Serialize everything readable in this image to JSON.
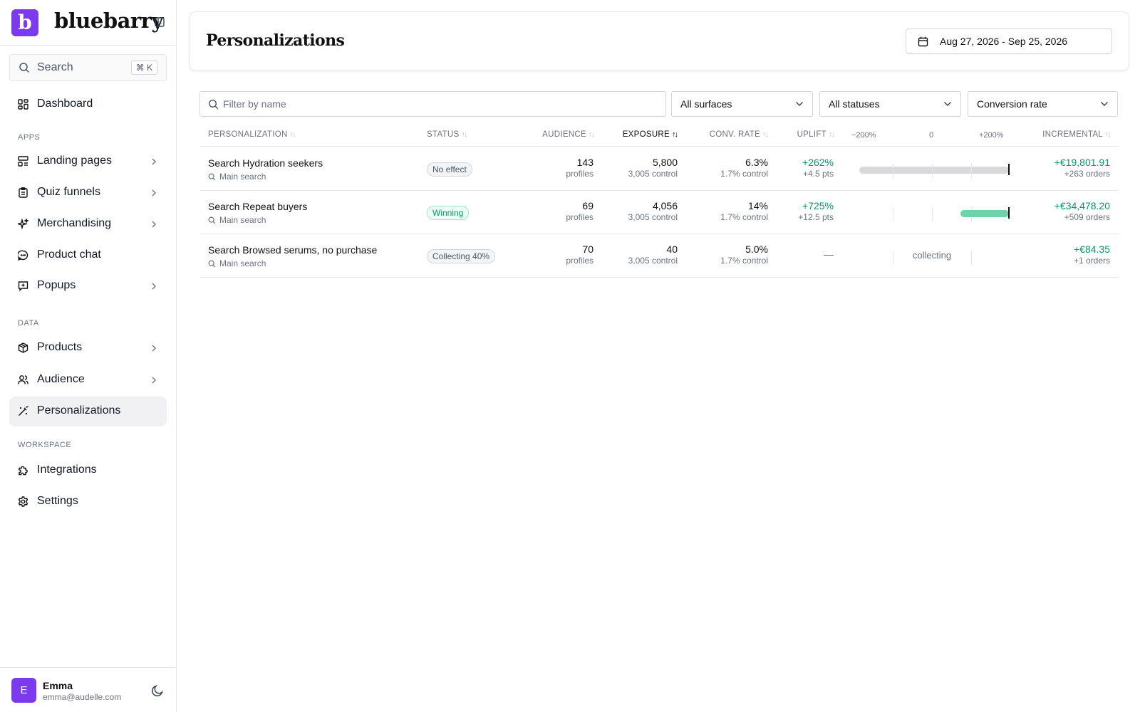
{
  "app": {
    "brand": "bluebarry",
    "logo_letter": "b",
    "accent": "#7c3aed"
  },
  "search": {
    "label": "Search",
    "shortcut": "⌘ K"
  },
  "sidebar": {
    "dashboard": "Dashboard",
    "sections": {
      "apps": "APPS",
      "data": "DATA",
      "workspace": "WORKSPACE"
    },
    "items": {
      "landing": "Landing pages",
      "quiz": "Quiz funnels",
      "merch": "Merchandising",
      "chat": "Product chat",
      "popups": "Popups",
      "products": "Products",
      "audience": "Audience",
      "personalizations": "Personalizations",
      "integrations": "Integrations",
      "settings": "Settings"
    }
  },
  "user": {
    "initial": "E",
    "name": "Emma",
    "email": "emma@audelle.com"
  },
  "header": {
    "title": "Personalizations",
    "date_range": "Aug 27, 2026 - Sep 25, 2026"
  },
  "filters": {
    "name_placeholder": "Filter by name",
    "surfaces": "All surfaces",
    "statuses": "All statuses",
    "metric": "Conversion rate"
  },
  "table": {
    "columns": {
      "personalization": "PERSONALIZATION",
      "status": "STATUS",
      "audience": "AUDIENCE",
      "exposure": "EXPOSURE",
      "conv_rate": "CONV. RATE",
      "uplift": "UPLIFT",
      "scale_min": "−200%",
      "scale_mid": "0",
      "scale_max": "+200%",
      "incremental": "INCREMENTAL"
    },
    "rows": [
      {
        "name": "Search Hydration seekers",
        "surface": "Main search",
        "status": "No effect",
        "audience": "143",
        "audience_sub": "profiles",
        "exposure": "5,800",
        "exposure_sub": "3,005 control",
        "conv": "6.3%",
        "conv_sub": "1.7% control",
        "uplift": "+262%",
        "uplift_sub": "+4.5 pts",
        "incremental": "+€19,801.91",
        "incremental_sub": "+263 orders",
        "uplift_value_pct": 262
      },
      {
        "name": "Search Repeat buyers",
        "surface": "Main search",
        "status": "Winning",
        "audience": "69",
        "audience_sub": "profiles",
        "exposure": "4,056",
        "exposure_sub": "3,005 control",
        "conv": "14%",
        "conv_sub": "1.7% control",
        "uplift": "+725%",
        "uplift_sub": "+12.5 pts",
        "incremental": "+€34,478.20",
        "incremental_sub": "+509 orders",
        "uplift_value_pct": 725
      },
      {
        "name": "Search Browsed serums, no purchase",
        "surface": "Main search",
        "status": "Collecting 40%",
        "audience": "70",
        "audience_sub": "profiles",
        "exposure": "40",
        "exposure_sub": "3,005 control",
        "conv": "5.0%",
        "conv_sub": "1.7% control",
        "uplift": "—",
        "chart_text": "collecting",
        "incremental": "+€84.35",
        "incremental_sub": "+1 orders"
      }
    ]
  }
}
